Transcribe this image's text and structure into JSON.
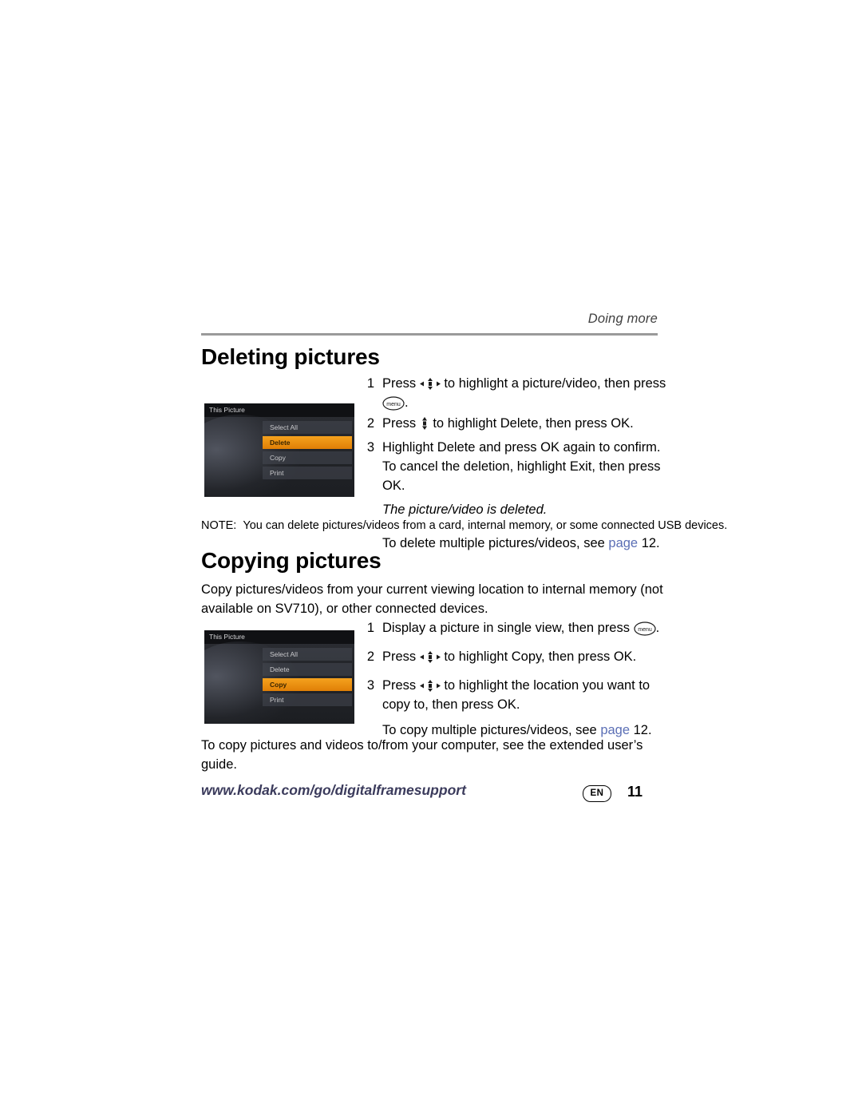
{
  "header": {
    "running_head": "Doing more"
  },
  "sections": [
    {
      "id": "deleting",
      "title": "Deleting pictures"
    },
    {
      "id": "copying",
      "title": "Copying pictures"
    }
  ],
  "deleting_steps": [
    {
      "num": "1",
      "text_before": "Press ",
      "icon": "four-way-arrow-icon",
      "text_after": " to highlight a picture/video, then press ",
      "trailing_icon": "menu-key-icon",
      "text_end": "."
    },
    {
      "num": "2",
      "text_before": "Press ",
      "icon": "up-down-arrow-icon",
      "text_after": " to highlight Delete, then press OK."
    },
    {
      "num": "3",
      "text": "Highlight Delete and press OK again to confirm. To cancel the deletion, highlight Exit, then press OK."
    }
  ],
  "deleting_extra": {
    "italic_note": "The picture/video is deleted.",
    "multi_note_before": "To delete multiple pictures/videos, see ",
    "multi_note_link": "page",
    "multi_note_after": " 12."
  },
  "note": {
    "label": "NOTE:",
    "text": "You can delete pictures/videos from a card, internal memory, or some connected USB devices."
  },
  "copying_intro": "Copy pictures/videos from your current viewing location to internal memory (not available on SV710), or other connected devices.",
  "copying_steps": [
    {
      "num": "1",
      "text_before": "Display a picture in single view, then press ",
      "trailing_icon": "menu-key-icon",
      "text_end": "."
    },
    {
      "num": "2",
      "text_before": "Press ",
      "icon": "four-way-arrow-icon",
      "text_after": " to highlight Copy, then press OK."
    },
    {
      "num": "3",
      "text_before": "Press ",
      "icon": "four-way-arrow-icon",
      "text_after": " to highlight the location you want to copy to, then press OK."
    }
  ],
  "copying_extra": {
    "multi_note_before": "To copy multiple pictures/videos, see ",
    "multi_note_link": "page",
    "multi_note_after": " 12."
  },
  "closing_para": "To copy pictures and videos to/from your computer, see the extended user’s guide.",
  "footer": {
    "url": "www.kodak.com/go/digitalframesupport",
    "language_badge": "EN",
    "page_number": "11"
  },
  "devices": [
    {
      "title": "This Picture",
      "menu": [
        {
          "label": "Select All",
          "selected": false
        },
        {
          "label": "Delete",
          "selected": true
        },
        {
          "label": "Copy",
          "selected": false
        },
        {
          "label": "Print",
          "selected": false
        }
      ]
    },
    {
      "title": "This Picture",
      "menu": [
        {
          "label": "Select All",
          "selected": false
        },
        {
          "label": "Delete",
          "selected": false
        },
        {
          "label": "Copy",
          "selected": true
        },
        {
          "label": "Print",
          "selected": false
        }
      ]
    }
  ],
  "colors": {
    "highlight": "#e8890a",
    "link": "#5b6fb5",
    "rule": "#9a9a9a",
    "footer_url": "#3b3b5c"
  }
}
